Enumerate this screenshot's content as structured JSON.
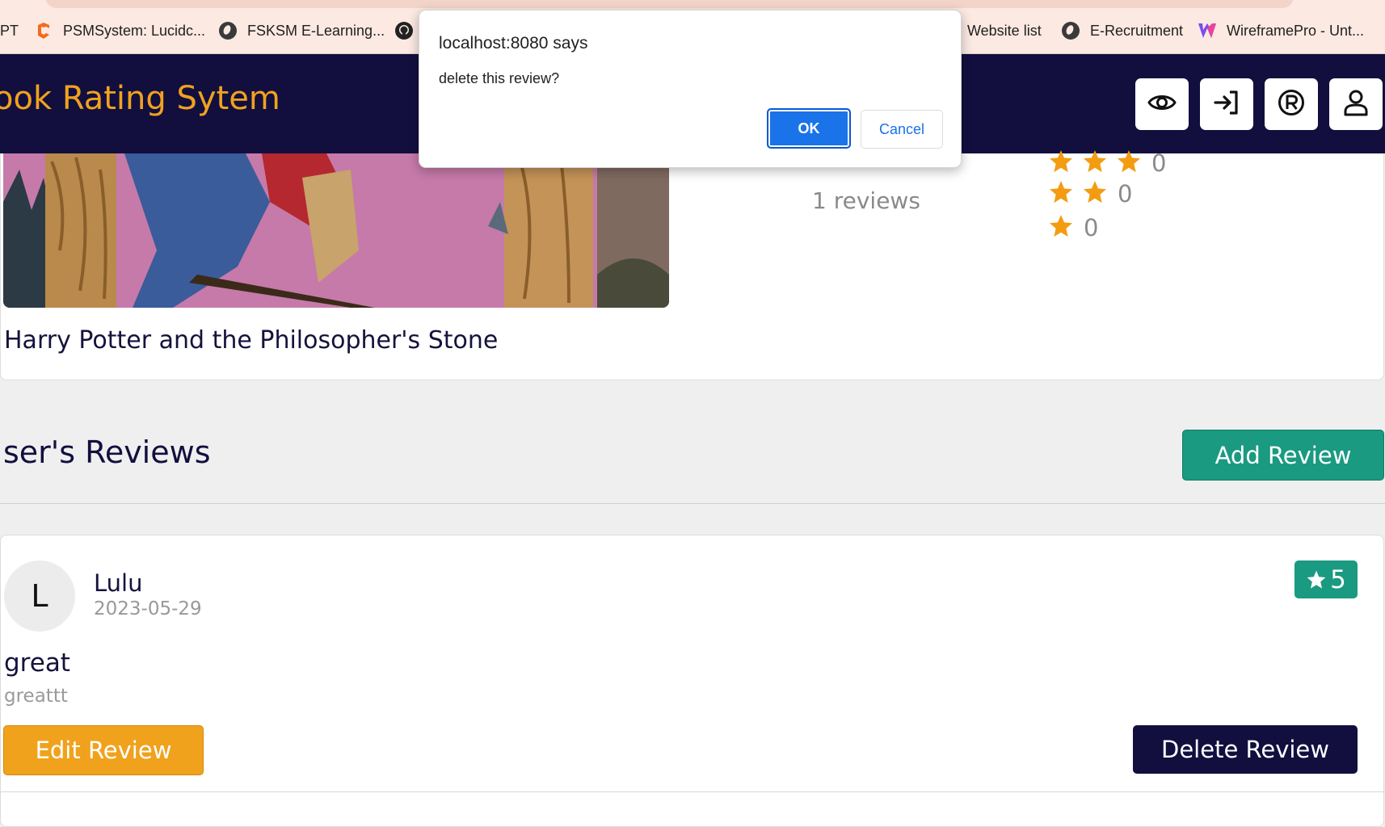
{
  "bookmarks": {
    "items": [
      {
        "label": "PT",
        "icon": "none"
      },
      {
        "label": "PSMSystem: Lucidc...",
        "icon": "lucidchart-icon"
      },
      {
        "label": "FSKSM E-Learning...",
        "icon": "globe-icon"
      },
      {
        "label": "",
        "icon": "github-icon"
      },
      {
        "label": "Website list",
        "icon": "none"
      },
      {
        "label": "E-Recruitment",
        "icon": "globe-icon"
      },
      {
        "label": "WireframePro - Unt...",
        "icon": "wireframepro-icon"
      }
    ]
  },
  "navbar": {
    "brand": "ook Rating Sytem",
    "buttons": [
      "eye-icon",
      "login-icon",
      "registered-icon",
      "user-icon"
    ]
  },
  "book": {
    "title": "Harry Potter and the Philosopher's Stone",
    "reviews_count": "1 reviews",
    "rating_breakdown": [
      {
        "stars": 3,
        "count": "0"
      },
      {
        "stars": 2,
        "count": "0"
      },
      {
        "stars": 1,
        "count": "0"
      }
    ]
  },
  "reviews_section": {
    "title": "ser's Reviews",
    "add_label": "Add Review"
  },
  "review": {
    "avatar_letter": "L",
    "name": "Lulu",
    "date": "2023-05-29",
    "rating": "5",
    "title": "great",
    "body": "greattt",
    "edit_label": "Edit Review",
    "delete_label": "Delete Review"
  },
  "dialog": {
    "title": "localhost:8080 says",
    "message": "delete this review?",
    "ok_label": "OK",
    "cancel_label": "Cancel"
  },
  "colors": {
    "navbar": "#120f3f",
    "brand": "#f0a21d",
    "accent_green": "#1a9a80",
    "star": "#f39c12",
    "dialog_ok": "#1a73e8"
  }
}
